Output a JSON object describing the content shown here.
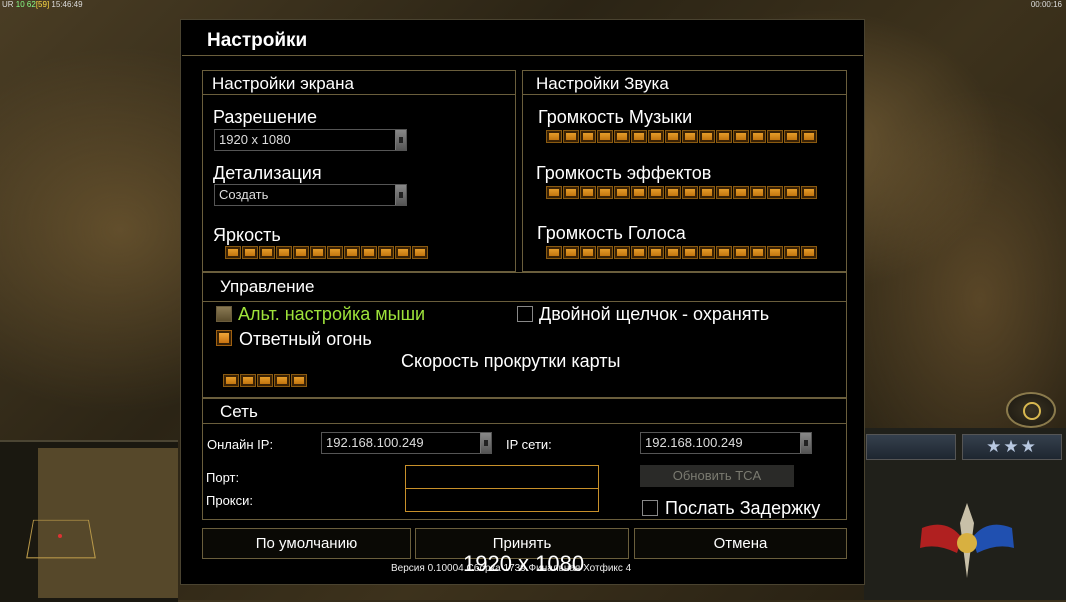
{
  "hud": {
    "top_left": {
      "prefix": "UR",
      "fps": "10 62",
      "fps_bracket": "[59]",
      "time": "15:46:49"
    },
    "top_right": "00:00:16"
  },
  "dialog": {
    "title": "Настройки",
    "screen": {
      "title": "Настройки экрана",
      "resolution_label": "Разрешение",
      "resolution_value": "1920 x 1080",
      "detail_label": "Детализация",
      "detail_value": "Создать",
      "brightness_label": "Яркость",
      "brightness_level": 1.0
    },
    "sound": {
      "title": "Настройки Звука",
      "music_label": "Громкость Музыки",
      "music_level": 1.0,
      "effects_label": "Громкость эффектов",
      "effects_level": 1.0,
      "voice_label": "Громкость Голоса",
      "voice_level": 1.0
    },
    "controls": {
      "title": "Управление",
      "alt_mouse_label": "Альт. настройка мыши",
      "alt_mouse_checked": false,
      "double_click_label": "Двойной щелчок - охранять",
      "double_click_checked": false,
      "return_fire_label": "Ответный огонь",
      "return_fire_checked": true,
      "scroll_speed_label": "Скорость прокрутки карты",
      "scroll_speed_level": 1.0
    },
    "network": {
      "title": "Сеть",
      "online_ip_label": "Онлайн IP:",
      "online_ip_value": "192.168.100.249",
      "lan_ip_label": "IP сети:",
      "lan_ip_value": "192.168.100.249",
      "port_label": "Порт:",
      "port_value": "",
      "proxy_label": "Прокси:",
      "proxy_value": "",
      "update_button": "Обновить TCA",
      "send_delay_label": "Послать Задержку",
      "send_delay_checked": false
    },
    "buttons": {
      "default": "По умолчанию",
      "accept": "Принять",
      "cancel": "Отмена"
    },
    "version": "Версия 0.10004 Сборка 1739 Финальная Хотфикс 4",
    "overlay_text": "1920 x 1080"
  },
  "colors": {
    "accent": "#f0a830",
    "border": "#6a5e3c",
    "highlight": "#9ee23a"
  }
}
